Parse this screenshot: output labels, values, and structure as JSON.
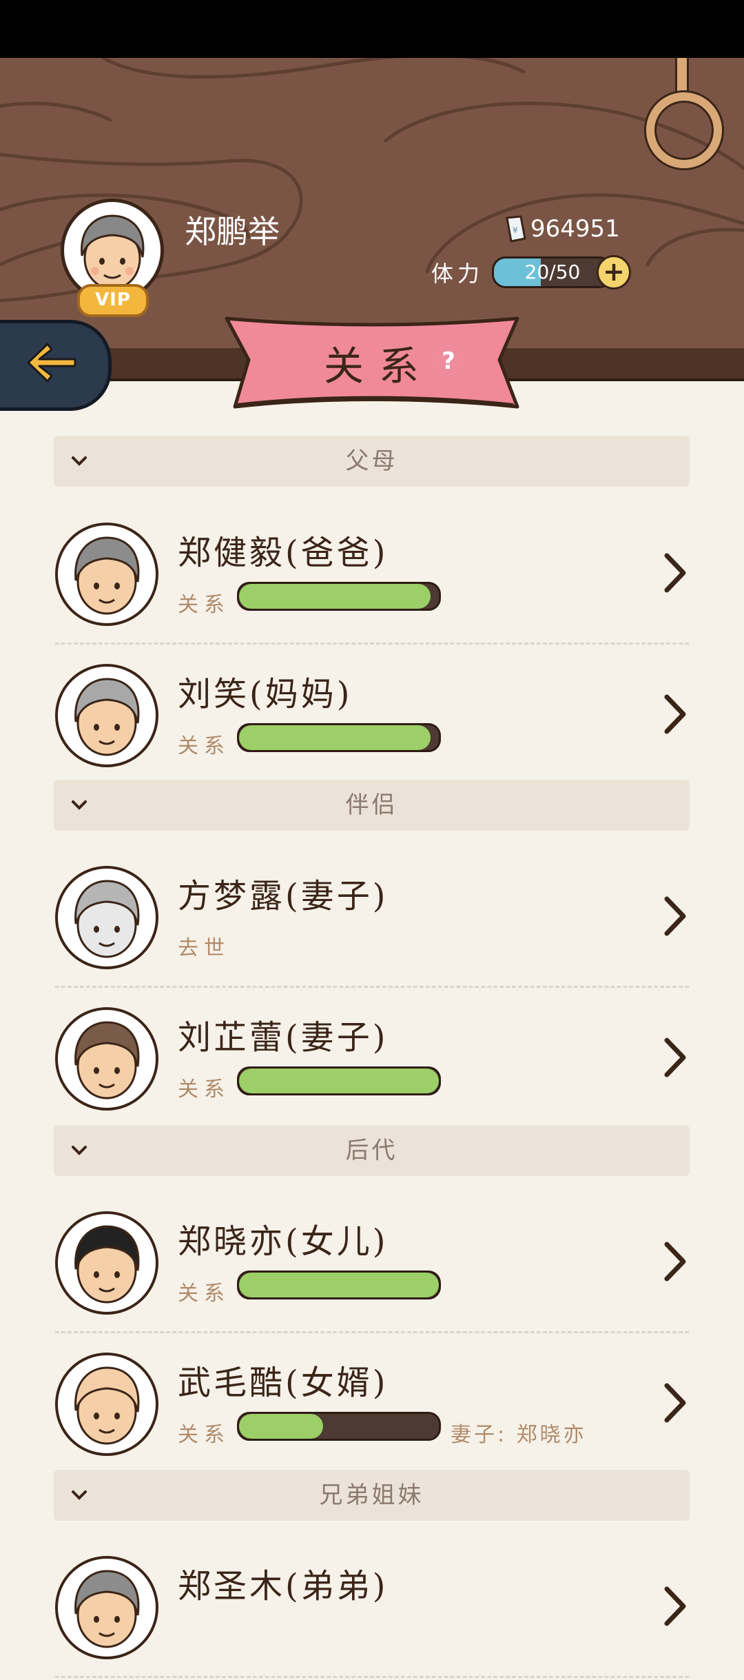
{
  "header": {
    "player_name": "郑鹏举",
    "vip_label": "VIP",
    "money": "964951",
    "stamina_label": "体力",
    "stamina_text": "20/50",
    "stamina_value": 20,
    "stamina_max": 50,
    "plus_label": "+",
    "title": "关系",
    "help_label": "?"
  },
  "icons": [
    "back-arrow-icon",
    "money-note-icon",
    "plus-icon",
    "help-icon",
    "chevron-down-icon",
    "chevron-right-icon",
    "hanging-ring-icon"
  ],
  "colors": {
    "wood": "#7a5545",
    "ribbon": "#f08a9a",
    "bar_fill": "#9ccf68",
    "stamina_fill": "#6cc1d8",
    "background": "#f6f2ea"
  },
  "sections": [
    {
      "title": "父母",
      "members": [
        {
          "name": "郑健毅(爸爸)",
          "relation_label": "关系",
          "relation": 0.96,
          "status": ""
        },
        {
          "name": "刘笑(妈妈)",
          "relation_label": "关系",
          "relation": 0.96,
          "status": ""
        }
      ]
    },
    {
      "title": "伴侣",
      "members": [
        {
          "name": "方梦露(妻子)",
          "relation_label": "",
          "relation": null,
          "status": "去世"
        },
        {
          "name": "刘芷蕾(妻子)",
          "relation_label": "关系",
          "relation": 1.0,
          "status": ""
        }
      ]
    },
    {
      "title": "后代",
      "members": [
        {
          "name": "郑晓亦(女儿)",
          "relation_label": "关系",
          "relation": 1.0,
          "status": ""
        },
        {
          "name": "武毛酷(女婿)",
          "relation_label": "关系",
          "relation": 0.42,
          "status": "",
          "spouse": "妻子: 郑晓亦"
        }
      ]
    },
    {
      "title": "兄弟姐妹",
      "members": [
        {
          "name": "郑圣木(弟弟)",
          "relation_label": "",
          "relation": null,
          "status": ""
        }
      ]
    }
  ]
}
